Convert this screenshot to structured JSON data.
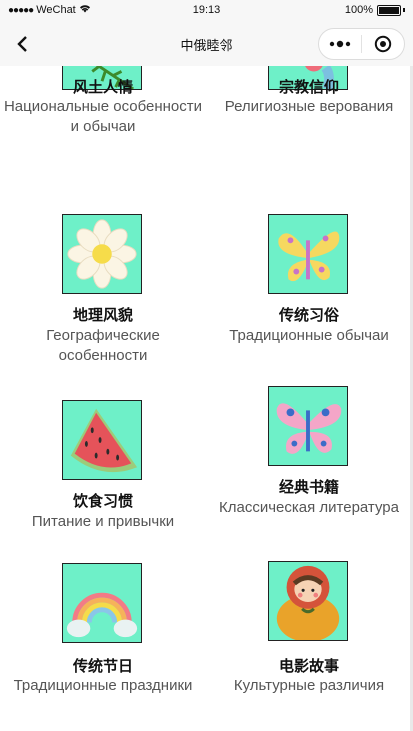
{
  "status_bar": {
    "carrier": "WeChat",
    "time": "19:13",
    "battery": "100%"
  },
  "nav": {
    "title": "中俄睦邻"
  },
  "categories": [
    {
      "cn": "风土人情",
      "ru": "Национальные особенности и обычаи",
      "icon": "flower-branch-icon"
    },
    {
      "cn": "宗教信仰",
      "ru": "Религиозные верования",
      "icon": "balloon-flower-icon"
    },
    {
      "cn": "地理风貌",
      "ru": "Географические особенности",
      "icon": "daisy-icon"
    },
    {
      "cn": "传统习俗",
      "ru": "Традиционные обычаи",
      "icon": "yellow-butterfly-icon"
    },
    {
      "cn": "饮食习惯",
      "ru": "Питание и привычки",
      "icon": "watermelon-icon"
    },
    {
      "cn": "经典书籍",
      "ru": "Классическая литература",
      "icon": "pink-butterfly-icon"
    },
    {
      "cn": "传统节日",
      "ru": "Традиционные праздники",
      "icon": "rainbow-icon"
    },
    {
      "cn": "电影故事",
      "ru": "Культурные различия",
      "icon": "matryoshka-icon"
    }
  ],
  "colors": {
    "thumb_bg": "#6ef0c8",
    "nav_bg": "#f7f7f7"
  }
}
